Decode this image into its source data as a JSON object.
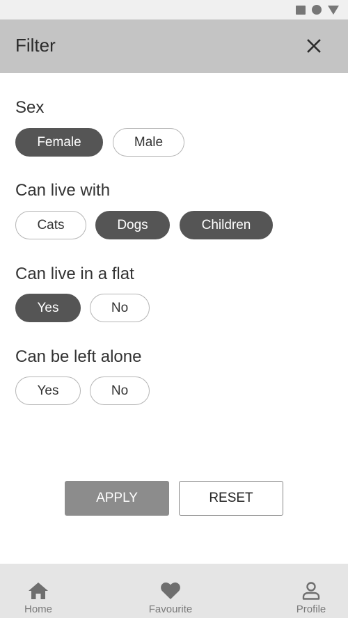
{
  "app_bar": {
    "title": "Filter",
    "close_icon": "close-icon"
  },
  "sections": [
    {
      "title": "Sex",
      "options": [
        {
          "label": "Female",
          "selected": true
        },
        {
          "label": "Male",
          "selected": false
        }
      ]
    },
    {
      "title": "Can live with",
      "options": [
        {
          "label": "Cats",
          "selected": false
        },
        {
          "label": "Dogs",
          "selected": true
        },
        {
          "label": "Children",
          "selected": true
        }
      ]
    },
    {
      "title": "Can live in a flat",
      "options": [
        {
          "label": "Yes",
          "selected": true
        },
        {
          "label": "No",
          "selected": false
        }
      ]
    },
    {
      "title": "Can be left alone",
      "options": [
        {
          "label": "Yes",
          "selected": false
        },
        {
          "label": "No",
          "selected": false
        }
      ]
    }
  ],
  "actions": {
    "apply_label": "APPLY",
    "reset_label": "RESET"
  },
  "bottom_nav": [
    {
      "label": "Home",
      "icon": "home-icon"
    },
    {
      "label": "Favourite",
      "icon": "heart-icon"
    },
    {
      "label": "Profile",
      "icon": "person-icon"
    }
  ],
  "colors": {
    "app_bar": "#c4c4c4",
    "chip_selected": "#555555",
    "apply_button": "#8c8c8c",
    "bottom_nav": "#e5e5e5"
  }
}
